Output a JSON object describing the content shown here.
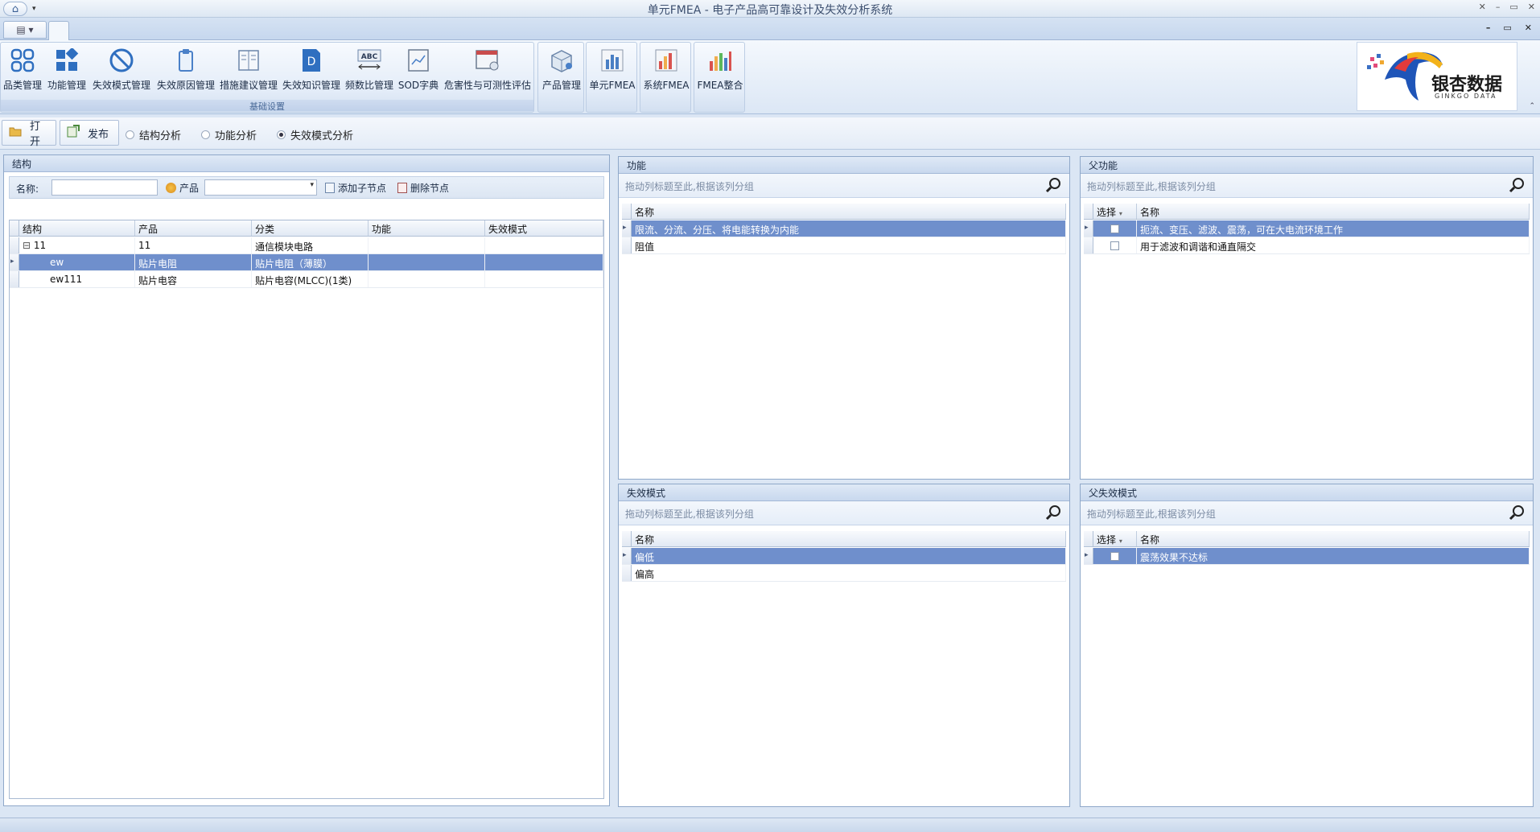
{
  "window": {
    "title": "单元FMEA - 电子产品高可靠设计及失效分析系统",
    "home_icon": "home-icon",
    "controls": [
      "✕",
      "–",
      "▭",
      "✕"
    ],
    "mdi_controls": [
      "–",
      "▭",
      "✕"
    ]
  },
  "ribbon": {
    "group1_label": "基础设置",
    "buttons": [
      {
        "label": "品类管理",
        "icon": "category-grid-icon"
      },
      {
        "label": "功能管理",
        "icon": "function-blocks-icon"
      },
      {
        "label": "失效模式管理",
        "icon": "prohibited-icon"
      },
      {
        "label": "失效原因管理",
        "icon": "clipboard-icon"
      },
      {
        "label": "措施建议管理",
        "icon": "document-list-icon"
      },
      {
        "label": "失效知识管理",
        "icon": "knowledge-d-icon"
      },
      {
        "label": "频数比管理",
        "icon": "abc-ruler-icon"
      },
      {
        "label": "SOD字典",
        "icon": "chart-book-icon"
      },
      {
        "label": "危害性与可测性评估",
        "icon": "window-settings-icon"
      }
    ],
    "buttons2": [
      {
        "label": "产品管理",
        "icon": "product-box-icon"
      },
      {
        "label": "单元FMEA",
        "icon": "bar-chart-icon"
      },
      {
        "label": "系统FMEA",
        "icon": "bar-chart-color-icon"
      },
      {
        "label": "FMEA整合",
        "icon": "bar-chart-integrate-icon"
      }
    ],
    "logo": {
      "text": "银杏数据",
      "sub": "GINKGO DATA"
    }
  },
  "toolbar": {
    "open_label": "打开",
    "publish_label": "发布",
    "radios": [
      {
        "label": "结构分析",
        "checked": false
      },
      {
        "label": "功能分析",
        "checked": false
      },
      {
        "label": "失效模式分析",
        "checked": true
      }
    ]
  },
  "structure": {
    "title": "结构",
    "name_label": "名称:",
    "name_value": "",
    "product_label": "产品",
    "product_value": "",
    "add_child": "添加子节点",
    "delete_node": "删除节点",
    "columns": [
      "结构",
      "产品",
      "分类",
      "功能",
      "失效模式"
    ],
    "rows": [
      {
        "structure": "11",
        "product": "11",
        "category": "通信模块电路",
        "function": "",
        "failure": "",
        "expander": "⊟"
      },
      {
        "structure": "ew",
        "product": "贴片电阻",
        "category": "贴片电阻（薄膜）",
        "function": "",
        "failure": ""
      },
      {
        "structure": "ew111",
        "product": "贴片电容",
        "category": "贴片电容(MLCC)(1类)",
        "function": "",
        "failure": ""
      }
    ]
  },
  "function_panel": {
    "title": "功能",
    "group_hint": "拖动列标题至此,根据该列分组",
    "columns": [
      "名称"
    ],
    "rows": [
      "限流、分流、分压、将电能转换为内能",
      "阻值"
    ]
  },
  "parent_function_panel": {
    "title": "父功能",
    "group_hint": "拖动列标题至此,根据该列分组",
    "columns": [
      "选择",
      "名称"
    ],
    "rows": [
      "扼流、变压、滤波、震荡，可在大电流环境工作",
      "用于滤波和调谐和通直隔交"
    ]
  },
  "failure_mode_panel": {
    "title": "失效模式",
    "group_hint": "拖动列标题至此,根据该列分组",
    "columns": [
      "名称"
    ],
    "rows": [
      "偏低",
      "偏高"
    ]
  },
  "parent_failure_panel": {
    "title": "父失效模式",
    "group_hint": "拖动列标题至此,根据该列分组",
    "columns": [
      "选择",
      "名称"
    ],
    "rows": [
      "震荡效果不达标"
    ]
  }
}
